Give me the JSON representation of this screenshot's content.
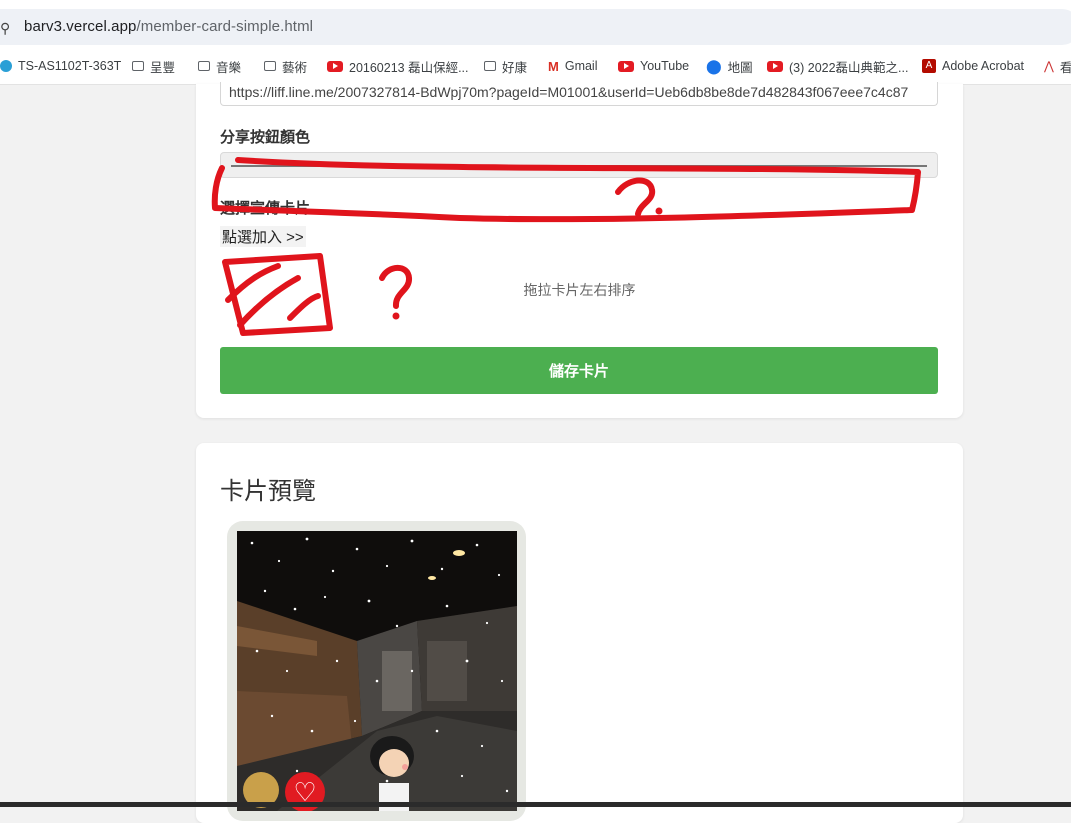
{
  "browser": {
    "url_host": "barv3.vercel.app",
    "url_path": "/member-card-simple.html",
    "bookmarks": [
      {
        "label": "TS-AS1102T-363T",
        "icon": "nas-icon"
      },
      {
        "label": "呈豐",
        "icon": "folder-icon"
      },
      {
        "label": "音樂",
        "icon": "folder-icon"
      },
      {
        "label": "藝術",
        "icon": "folder-icon"
      },
      {
        "label": "20160213 磊山保經...",
        "icon": "youtube-icon"
      },
      {
        "label": "好康",
        "icon": "folder-icon"
      },
      {
        "label": "Gmail",
        "icon": "gmail-icon"
      },
      {
        "label": "YouTube",
        "icon": "youtube-icon"
      },
      {
        "label": "地圖",
        "icon": "maps-icon"
      },
      {
        "label": "(3) 2022磊山典範之...",
        "icon": "youtube-icon"
      },
      {
        "label": "Adobe Acrobat",
        "icon": "acrobat-icon"
      },
      {
        "label": "看",
        "icon": "bookmark-icon"
      }
    ]
  },
  "form": {
    "share_link_value": "https://liff.line.me/2007327814-BdWpj70m?pageId=M01001&userId=Ueb6db8be8de7d482843f067eee7c4c87",
    "share_button_color_label": "分享按鈕顏色",
    "select_card_label": "選擇宣傳卡片",
    "add_link": "點選加入 >>",
    "drag_hint": "拖拉卡片左右排序",
    "save_button": "儲存卡片"
  },
  "preview": {
    "title": "卡片預覽"
  },
  "annotations": {
    "question_mark": "?",
    "color": "#e0141c"
  },
  "colors": {
    "save_button": "#4caf50",
    "annotation": "#e0141c"
  }
}
